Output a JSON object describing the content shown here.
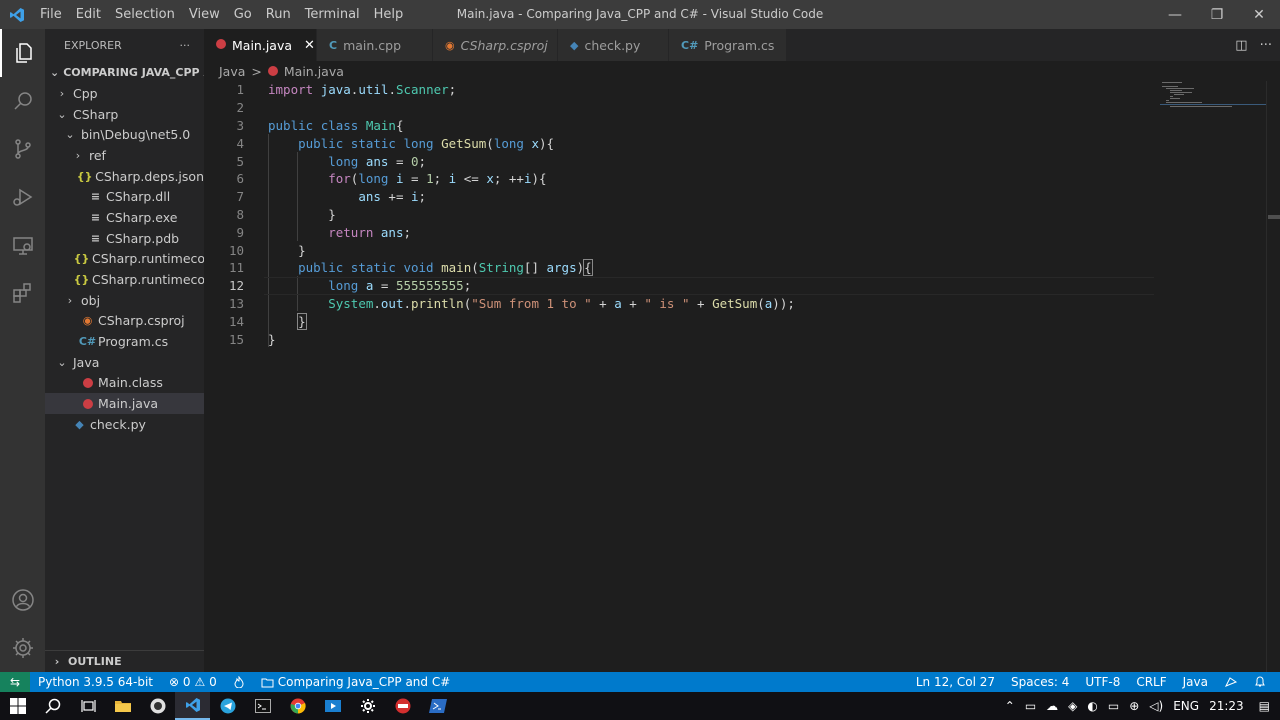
{
  "window": {
    "title": "Main.java - Comparing Java_CPP and C# - Visual Studio Code",
    "menu": [
      "File",
      "Edit",
      "Selection",
      "View",
      "Go",
      "Run",
      "Terminal",
      "Help"
    ],
    "controls": {
      "minimize": "—",
      "restore": "❐",
      "close": "✕"
    }
  },
  "sidebar": {
    "header": "EXPLORER",
    "more": "···",
    "root": "COMPARING JAVA_CPP A...",
    "items": [
      {
        "label": "Cpp",
        "indent": 1,
        "chev": "›",
        "icon": ""
      },
      {
        "label": "CSharp",
        "indent": 1,
        "chev": "⌄",
        "icon": ""
      },
      {
        "label": "bin\\Debug\\net5.0",
        "indent": 2,
        "chev": "⌄",
        "icon": ""
      },
      {
        "label": "ref",
        "indent": 3,
        "chev": "›",
        "icon": ""
      },
      {
        "label": "CSharp.deps.json",
        "indent": 3,
        "chev": "",
        "icon": "json"
      },
      {
        "label": "CSharp.dll",
        "indent": 3,
        "chev": "",
        "icon": "bin"
      },
      {
        "label": "CSharp.exe",
        "indent": 3,
        "chev": "",
        "icon": "bin"
      },
      {
        "label": "CSharp.pdb",
        "indent": 3,
        "chev": "",
        "icon": "bin"
      },
      {
        "label": "CSharp.runtimecon...",
        "indent": 3,
        "chev": "",
        "icon": "json"
      },
      {
        "label": "CSharp.runtimecon...",
        "indent": 3,
        "chev": "",
        "icon": "json"
      },
      {
        "label": "obj",
        "indent": 2,
        "chev": "›",
        "icon": ""
      },
      {
        "label": "CSharp.csproj",
        "indent": 2,
        "chev": "",
        "icon": "rss"
      },
      {
        "label": "Program.cs",
        "indent": 2,
        "chev": "",
        "icon": "cs"
      },
      {
        "label": "Java",
        "indent": 1,
        "chev": "⌄",
        "icon": ""
      },
      {
        "label": "Main.class",
        "indent": 2,
        "chev": "",
        "icon": "java"
      },
      {
        "label": "Main.java",
        "indent": 2,
        "chev": "",
        "icon": "java",
        "selected": true
      },
      {
        "label": "check.py",
        "indent": 1,
        "chev": "",
        "icon": "py"
      }
    ],
    "outline": "OUTLINE"
  },
  "tabs": [
    {
      "label": "Main.java",
      "icon": "java",
      "active": true,
      "close": "✕"
    },
    {
      "label": "main.cpp",
      "icon": "C",
      "active": false
    },
    {
      "label": "CSharp.csproj",
      "icon": "rss",
      "active": false,
      "italic": true
    },
    {
      "label": "check.py",
      "icon": "py",
      "active": false
    },
    {
      "label": "Program.cs",
      "icon": "C#",
      "active": false
    }
  ],
  "tab_actions": {
    "split": "◫",
    "more": "···"
  },
  "breadcrumb": {
    "folder": "Java",
    "sep": ">",
    "file": "Main.java"
  },
  "editor": {
    "current_line": 12,
    "line_numbers": [
      "1",
      "2",
      "3",
      "4",
      "5",
      "6",
      "7",
      "8",
      "9",
      "10",
      "11",
      "12",
      "13",
      "14",
      "15"
    ]
  },
  "statusbar": {
    "remote": "⇆",
    "python": "Python 3.9.5 64-bit",
    "errors": "⊗ 0",
    "warnings": "⚠ 0",
    "folder": "Comparing Java_CPP and C#",
    "position": "Ln 12, Col 27",
    "spaces": "Spaces: 4",
    "encoding": "UTF-8",
    "eol": "CRLF",
    "language": "Java"
  },
  "taskbar": {
    "lang": "ENG",
    "time": "21:23"
  },
  "colors": {
    "statusbar": "#007acc",
    "titlebar": "#3c3c3c",
    "editor_bg": "#1e1e1e",
    "sidebar_bg": "#252526"
  }
}
